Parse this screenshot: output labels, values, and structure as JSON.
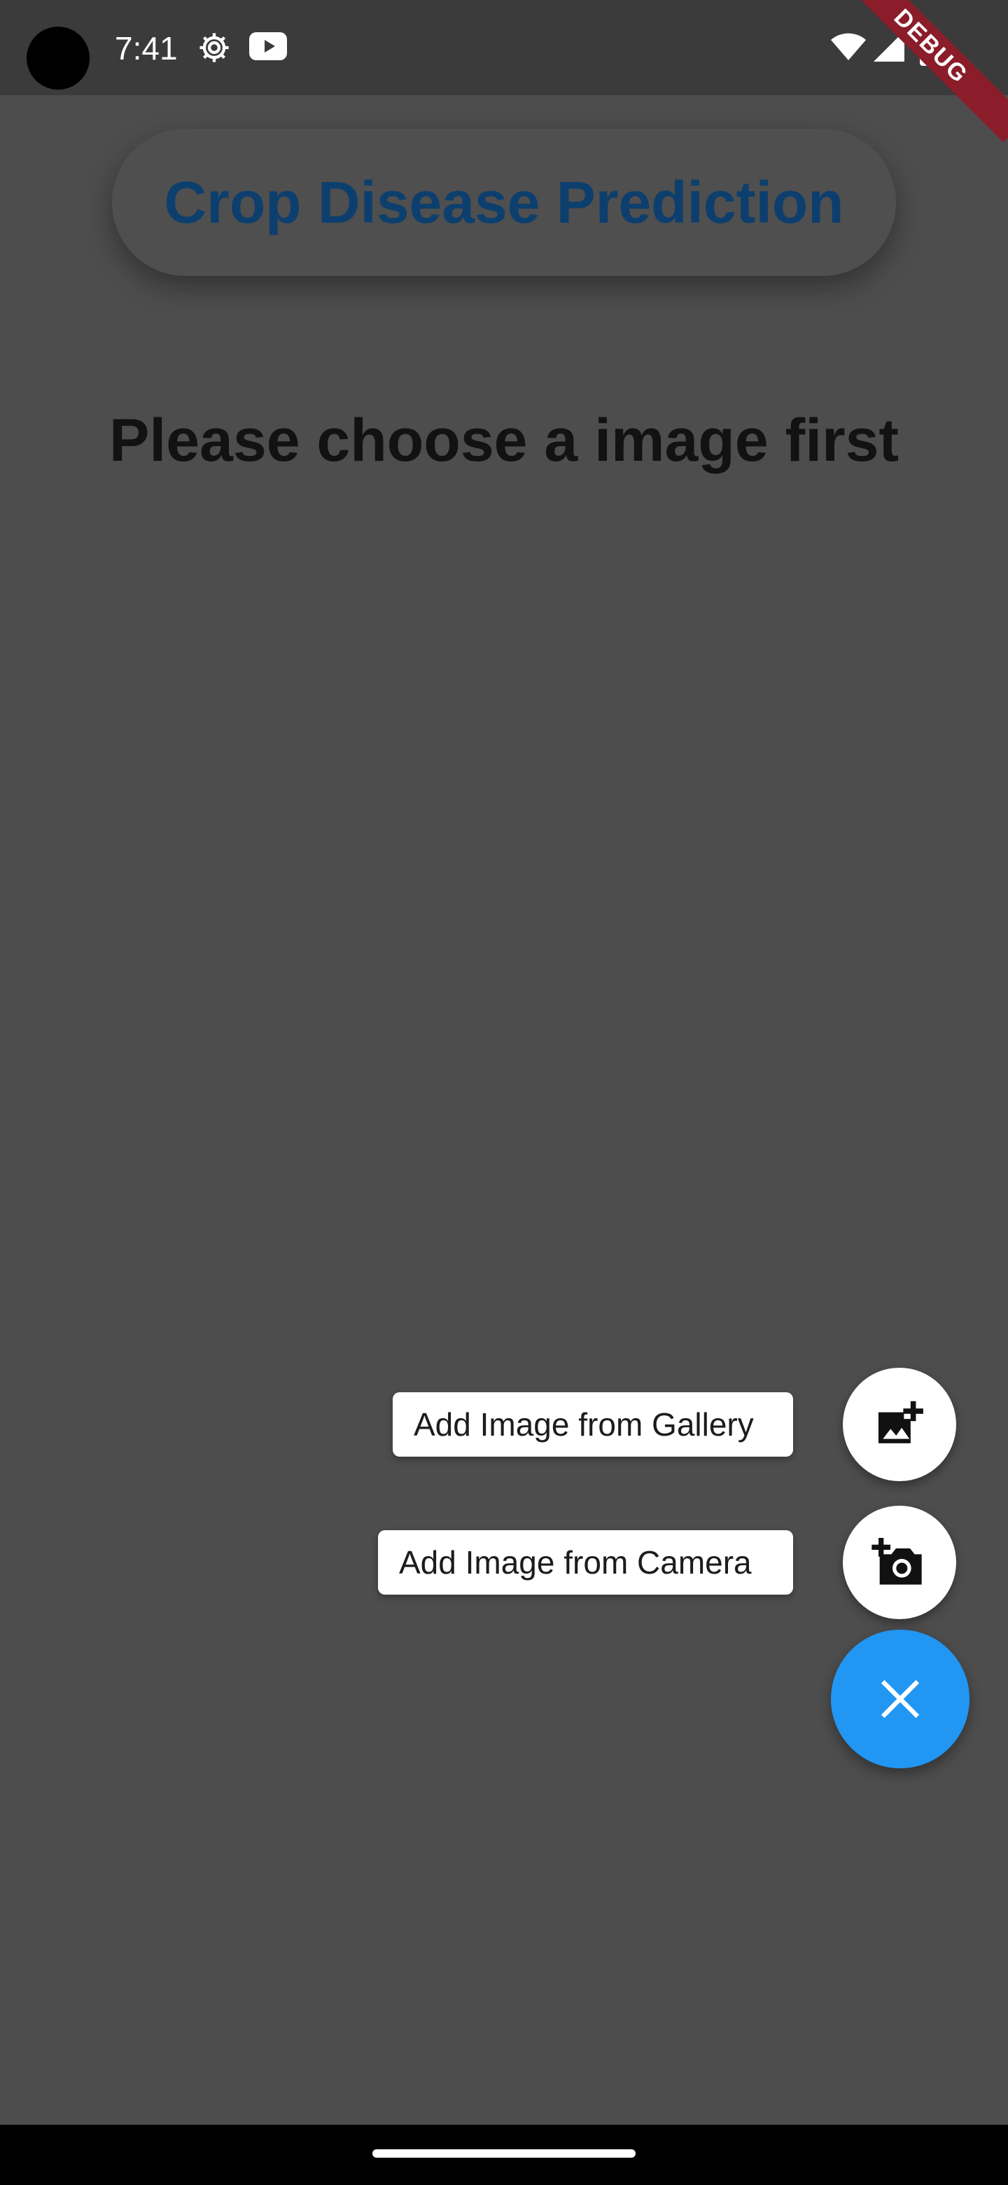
{
  "status_bar": {
    "time": "7:41",
    "icons": [
      "settings-gear-icon",
      "youtube-icon",
      "wifi-icon",
      "signal-icon",
      "battery-icon"
    ]
  },
  "debug_banner": {
    "label": "DEBUG"
  },
  "app_bar": {
    "title": "Crop Disease Prediction"
  },
  "main": {
    "prompt": "Please choose a image first"
  },
  "speed_dial": {
    "gallery_label": "Add Image from Gallery",
    "camera_label": "Add Image from Camera",
    "gallery_icon": "add-photo-icon",
    "camera_icon": "add-camera-icon",
    "close_icon": "close-icon"
  },
  "colors": {
    "fab": "#2196f3",
    "title": "#0d3f6e",
    "overlay_background": "#4d4d4d"
  }
}
